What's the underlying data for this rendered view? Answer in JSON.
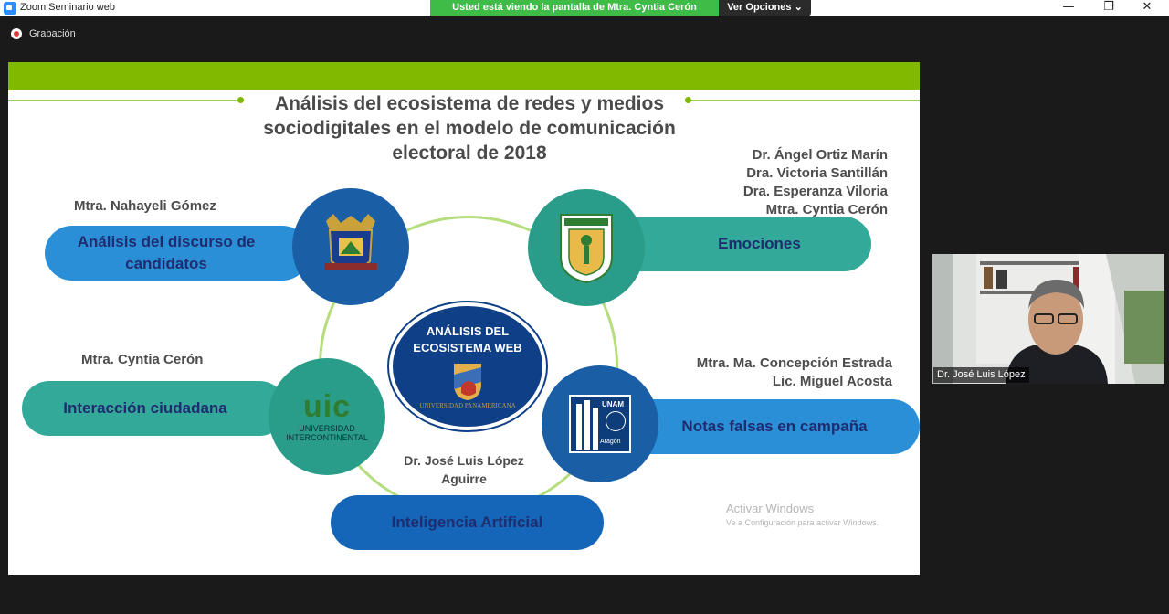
{
  "window": {
    "title": "Zoom Seminario web",
    "minimize_icon": "—",
    "restore_icon": "❐",
    "close_icon": "✕"
  },
  "share_banner": {
    "text": "Usted está viendo la pantalla de Mtra. Cyntia Cerón",
    "view_options": "Ver Opciones ⌄"
  },
  "recording": {
    "label": "Grabación"
  },
  "slide": {
    "title": "Análisis del ecosistema de redes y medios sociodigitales en el modelo de comunicación electoral de 2018",
    "center": {
      "title": "ANÁLISIS DEL ECOSISTEMA WEB",
      "sub": "UNIVERSIDAD PANAMERICANA"
    },
    "topics": [
      {
        "label": "Análisis del discurso de candidatos",
        "authors": [
          "Mtra. Nahayeli Gómez"
        ]
      },
      {
        "label": "Emociones",
        "authors": [
          "Dr. Ángel Ortiz Marín",
          "Dra. Victoria Santillán",
          "Dra. Esperanza Viloria",
          "Mtra. Cyntia Cerón"
        ]
      },
      {
        "label": "Interacción ciudadana",
        "authors": [
          "Mtra. Cyntia Cerón"
        ]
      },
      {
        "label": "Notas falsas en campaña",
        "authors": [
          "Mtra. Ma. Concepción Estrada",
          "Lic. Miguel Acosta"
        ]
      },
      {
        "label": "Inteligencia Artificial",
        "authors": [
          "Dr. José Luis López",
          "Aguirre"
        ]
      }
    ],
    "logos": {
      "uic_main": "UIC",
      "uic_sub1": "UNIVERSIDAD",
      "uic_sub2": "INTERCONTINENTAL",
      "unam_label": "UNAM",
      "aragon_label": "Aragón"
    },
    "watermark": {
      "line1": "Activar Windows",
      "line2": "Ve a Configuración para activar Windows."
    }
  },
  "video": {
    "participant": "Dr. José Luis López"
  },
  "colors": {
    "slide_green": "#7fba00",
    "pill_blue": "#2b8fd8",
    "pill_teal": "#33a99a",
    "pill_navy": "#1565b8",
    "share_green": "#3fbb47"
  }
}
